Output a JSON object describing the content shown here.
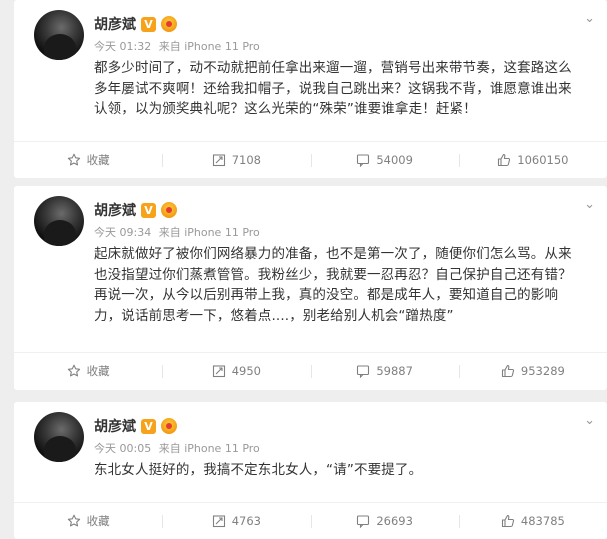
{
  "icons": {
    "favorite": "star-icon",
    "repost": "repost-icon",
    "comment": "comment-icon",
    "like": "thumbs-up-icon",
    "more": "chevron-down-icon"
  },
  "colors": {
    "text": "#333333",
    "meta": "#999999",
    "action": "#808080",
    "badge_v": "#f7a21b",
    "background": "#eeeeee"
  },
  "posts": [
    {
      "username": "胡彦斌",
      "verified_badge": "V",
      "meta": {
        "time": "今天 01:32",
        "source": "来自 iPhone 11 Pro"
      },
      "text": "都多少时间了，动不动就把前任拿出来遛一遛，营销号出来带节奏，这套路这么\n多年屡试不爽啊！还给我扣帽子，说我自己跳出来？这锅我不背，谁愿意谁出来\n认领，以为颁奖典礼呢？这么光荣的“殊荣”谁要谁拿走！赶紧！",
      "actions": {
        "favorite": "收藏",
        "repost": "7108",
        "comment": "54009",
        "like": "1060150"
      }
    },
    {
      "username": "胡彦斌",
      "verified_badge": "V",
      "meta": {
        "time": "今天 09:34",
        "source": "来自 iPhone 11 Pro"
      },
      "text": "起床就做好了被你们网络暴力的准备，也不是第一次了，随便你们怎么骂。从来\n也没指望过你们蒸煮管管。我粉丝少，我就要一忍再忍？自己保护自己还有错？\n再说一次，从今以后别再带上我，真的没空。都是成年人，要知道自己的影响\n力，说话前思考一下，悠着点....，别老给别人机会“蹭热度”",
      "actions": {
        "favorite": "收藏",
        "repost": "4950",
        "comment": "59887",
        "like": "953289"
      }
    },
    {
      "username": "胡彦斌",
      "verified_badge": "V",
      "meta": {
        "time": "今天 00:05",
        "source": "来自 iPhone 11 Pro"
      },
      "text": "东北女人挺好的，我搞不定东北女人，“请”不要提了。",
      "actions": {
        "favorite": "收藏",
        "repost": "4763",
        "comment": "26693",
        "like": "483785"
      }
    }
  ]
}
